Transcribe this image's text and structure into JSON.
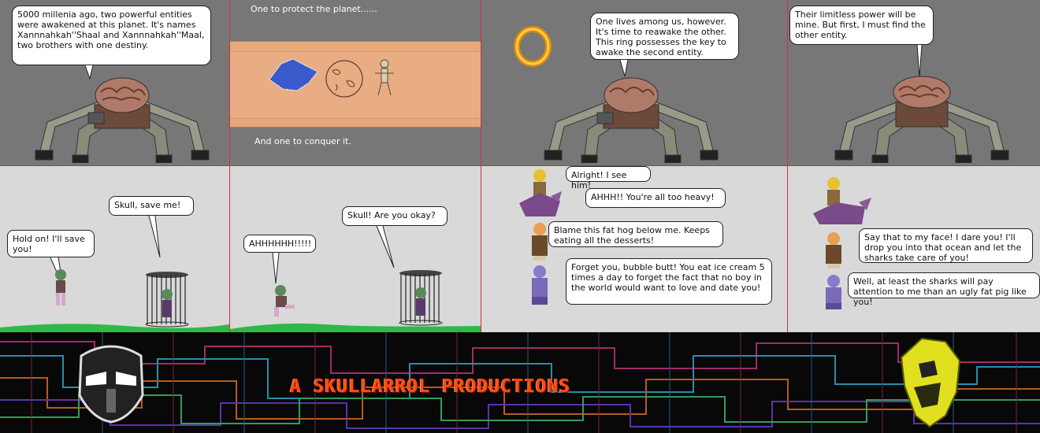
{
  "colors": {
    "panel_grey": "#777777",
    "panel_light": "#d9d9d9",
    "border": "#cc3344",
    "title": "#ff4a14",
    "ground": "#2fb84a"
  },
  "panels": {
    "p1": {
      "bubble": "5000 millenia ago, two powerful entities were awakened at this planet. It's names Xannnahkah''Shaal and Xannnahkah''Maal, two brothers with one destiny."
    },
    "p2": {
      "caption_top": "One to protect the planet......",
      "caption_bottom": "And one to conquer it."
    },
    "p3": {
      "bubble": "One lives among us, however. It's time to reawake the other. This ring possesses the key to awake the second entity."
    },
    "p4": {
      "bubble": "Their limitless power will be mine. But first, I must find the other entity."
    },
    "p5": {
      "bubble_left": "Hold on! I'll save you!",
      "bubble_right": "Skull, save me!"
    },
    "p6": {
      "bubble_left": "AHHHHHH!!!!!",
      "bubble_right": "Skull! Are you okay?"
    },
    "p7": {
      "b1": "Alright! I see him!",
      "b2": "AHHH!! You're all too heavy!",
      "b3": "Blame this fat hog below me. Keeps eating all the desserts!",
      "b4": "Forget you, bubble butt! You eat ice cream 5 times a day to forget the fact that no boy in the world would want to love and date you!"
    },
    "p8": {
      "b1": "Say that to my face! I dare you! I'll drop you into that ocean and let the sharks take care of you!",
      "b2": "Well, at least the sharks will pay attention to me than an ugly fat pig like you!"
    }
  },
  "banner": {
    "title": "A SKULLARROL PRODUCTIONS",
    "left_logo": "black-mask-icon",
    "right_logo": "yellow-mask-icon"
  }
}
